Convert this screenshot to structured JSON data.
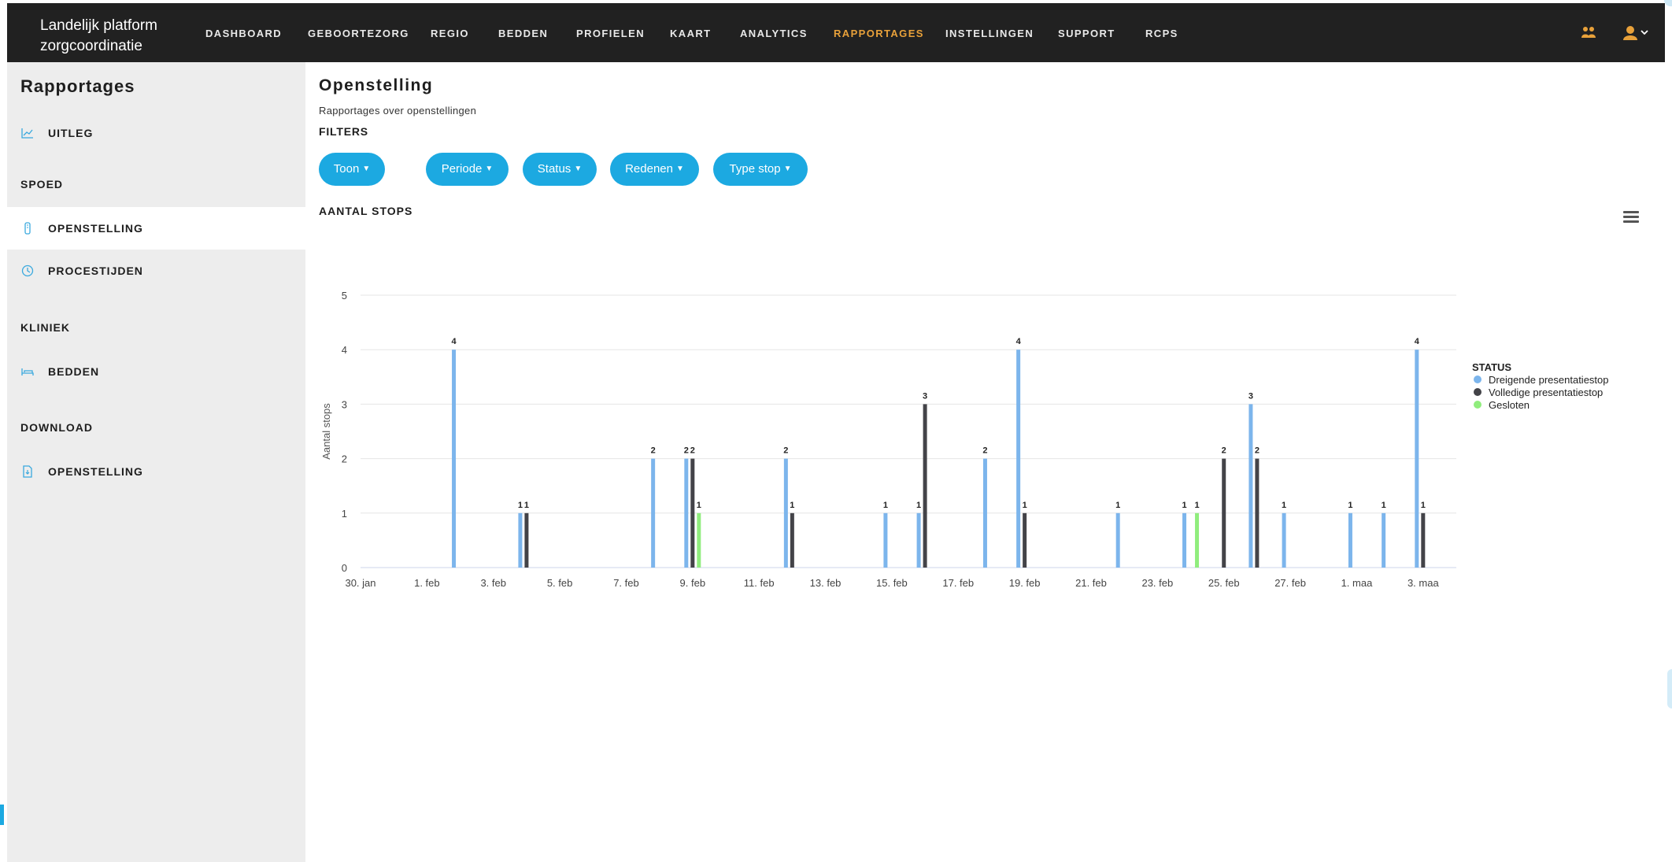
{
  "brand": {
    "line1": "Landelijk platform",
    "line2": "zorgcoordinatie"
  },
  "nav": {
    "items": [
      {
        "label": "DASHBOARD",
        "active": false
      },
      {
        "label": "GEBOORTEZORG",
        "active": false
      },
      {
        "label": "REGIO",
        "active": false
      },
      {
        "label": "BEDDEN",
        "active": false
      },
      {
        "label": "PROFIELEN",
        "active": false
      },
      {
        "label": "KAART",
        "active": false
      },
      {
        "label": "ANALYTICS",
        "active": false
      },
      {
        "label": "RAPPORTAGES",
        "active": true
      },
      {
        "label": "INSTELLINGEN",
        "active": false
      },
      {
        "label": "SUPPORT",
        "active": false
      },
      {
        "label": "RCPS",
        "active": false
      }
    ],
    "icons": [
      "team-icon",
      "user-icon",
      "chevron-down-icon"
    ],
    "accent": "#e8a13a"
  },
  "sidebar": {
    "title": "Rapportages",
    "uitleg": "UITLEG",
    "spoed": "SPOED",
    "openstelling": "OPENSTELLING",
    "procestijden": "PROCESTIJDEN",
    "kliniek": "KLINIEK",
    "bedden": "BEDDEN",
    "download": "DOWNLOAD",
    "download_openstelling": "OPENSTELLING"
  },
  "main": {
    "title": "Openstelling",
    "subtitle": "Rapportages over openstellingen",
    "filters_label": "FILTERS",
    "filters": [
      "Toon",
      "Periode",
      "Status",
      "Redenen",
      "Type stop"
    ],
    "chart_title": "AANTAL STOPS"
  },
  "colors": {
    "pill": "#1ca9e1",
    "blue": "#7cb5ec",
    "dark": "#434348",
    "green": "#90ed7d"
  },
  "chart_data": {
    "type": "bar",
    "title": "",
    "xlabel": "",
    "ylabel": "Aantal stops",
    "ylim": [
      0,
      5
    ],
    "yticks": [
      0,
      1,
      2,
      3,
      4,
      5
    ],
    "x_start": "30. jan",
    "x_end": "4. maa",
    "xticks": [
      "30. jan",
      "1. feb",
      "3. feb",
      "5. feb",
      "7. feb",
      "9. feb",
      "11. feb",
      "13. feb",
      "15. feb",
      "17. feb",
      "19. feb",
      "21. feb",
      "23. feb",
      "25. feb",
      "27. feb",
      "1. maa",
      "3. maa"
    ],
    "legend": {
      "title": "STATUS",
      "position": "right"
    },
    "series": [
      {
        "name": "Dreigende presentatiestop",
        "color": "#7cb5ec",
        "points": [
          [
            "2. feb",
            4
          ],
          [
            "4. feb",
            1
          ],
          [
            "8. feb",
            2
          ],
          [
            "9. feb",
            2
          ],
          [
            "12. feb",
            2
          ],
          [
            "15. feb",
            1
          ],
          [
            "16. feb",
            1
          ],
          [
            "18. feb",
            2
          ],
          [
            "19. feb",
            4
          ],
          [
            "22. feb",
            1
          ],
          [
            "24. feb",
            1
          ],
          [
            "26. feb",
            3
          ],
          [
            "27. feb",
            1
          ],
          [
            "1. maa",
            1
          ],
          [
            "2. maa",
            1
          ],
          [
            "3. maa",
            4
          ]
        ]
      },
      {
        "name": "Volledige presentatiestop",
        "color": "#434348",
        "points": [
          [
            "4. feb",
            1
          ],
          [
            "9. feb",
            2
          ],
          [
            "12. feb",
            1
          ],
          [
            "16. feb",
            3
          ],
          [
            "19. feb",
            1
          ],
          [
            "25. feb",
            2
          ],
          [
            "26. feb",
            2
          ],
          [
            "3. maa",
            1
          ]
        ]
      },
      {
        "name": "Gesloten",
        "color": "#90ed7d",
        "points": [
          [
            "9. feb",
            1
          ],
          [
            "24. feb",
            1
          ]
        ]
      }
    ]
  }
}
